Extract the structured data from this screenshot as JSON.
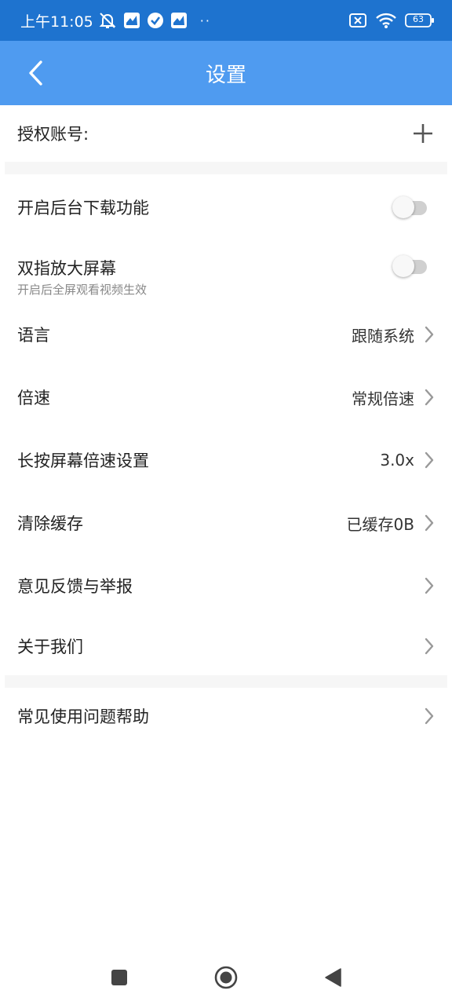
{
  "status_bar": {
    "time": "上午11:05",
    "dots": "··",
    "battery": "63",
    "icons_left": [
      "mute-bell-icon",
      "app-notification-icon",
      "check-circle-icon",
      "app-notification-icon"
    ],
    "icons_right": [
      "no-sim-icon",
      "wifi-icon",
      "battery-icon"
    ]
  },
  "header": {
    "title": "设置",
    "back_icon": "chevron-left-icon",
    "bg_color": "#4F9BF0",
    "status_color": "#1E73CF"
  },
  "auth": {
    "label": "授权账号:",
    "add_icon": "plus-icon"
  },
  "settings": {
    "background_download": {
      "label": "开启后台下载功能",
      "enabled": false
    },
    "pinch_zoom": {
      "label": "双指放大屏幕",
      "sublabel": "开启后全屏观看视频生效",
      "enabled": false
    },
    "language": {
      "label": "语言",
      "value": "跟随系统"
    },
    "speed": {
      "label": "倍速",
      "value": "常规倍速"
    },
    "long_press_speed": {
      "label": "长按屏幕倍速设置",
      "value": "3.0x"
    },
    "clear_cache": {
      "label": "清除缓存",
      "value": "已缓存0B"
    },
    "feedback": {
      "label": "意见反馈与举报"
    },
    "about": {
      "label": "关于我们"
    },
    "help": {
      "label": "常见使用问题帮助"
    }
  },
  "nav": {
    "buttons": [
      "recents-square-icon",
      "home-circle-icon",
      "back-triangle-icon"
    ]
  }
}
